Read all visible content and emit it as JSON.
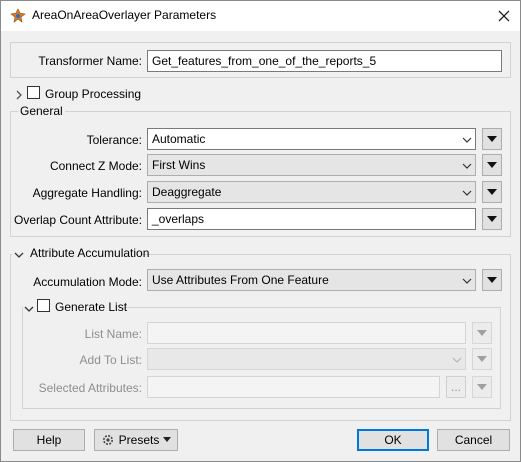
{
  "window": {
    "title": "AreaOnAreaOverlayer Parameters",
    "icons": {
      "app": "transformer-icon",
      "close": "close-icon"
    }
  },
  "transformer_name": {
    "label": "Transformer Name:",
    "value": "Get_features_from_one_of_the_reports_5"
  },
  "group_processing": {
    "label": "Group Processing",
    "checked": false
  },
  "general": {
    "title": "General",
    "tolerance": {
      "label": "Tolerance:",
      "value": "Automatic"
    },
    "connect_z_mode": {
      "label": "Connect Z Mode:",
      "value": "First Wins"
    },
    "aggregate_handling": {
      "label": "Aggregate Handling:",
      "value": "Deaggregate"
    },
    "overlap_count_attribute": {
      "label": "Overlap Count Attribute:",
      "value": "_overlaps"
    }
  },
  "attribute_accumulation": {
    "title": "Attribute Accumulation",
    "accumulation_mode": {
      "label": "Accumulation Mode:",
      "value": "Use Attributes From One Feature"
    },
    "generate_list": {
      "label": "Generate List",
      "checked": false,
      "list_name": {
        "label": "List Name:",
        "value": ""
      },
      "add_to_list": {
        "label": "Add To List:",
        "value": ""
      },
      "selected_attributes": {
        "label": "Selected Attributes:",
        "value": "",
        "browse_label": "..."
      }
    }
  },
  "footer": {
    "help_label": "Help",
    "presets_label": "Presets",
    "ok_label": "OK",
    "cancel_label": "Cancel"
  },
  "colors": {
    "accent": "#0078d7",
    "window_bg": "#f0f0f0"
  }
}
